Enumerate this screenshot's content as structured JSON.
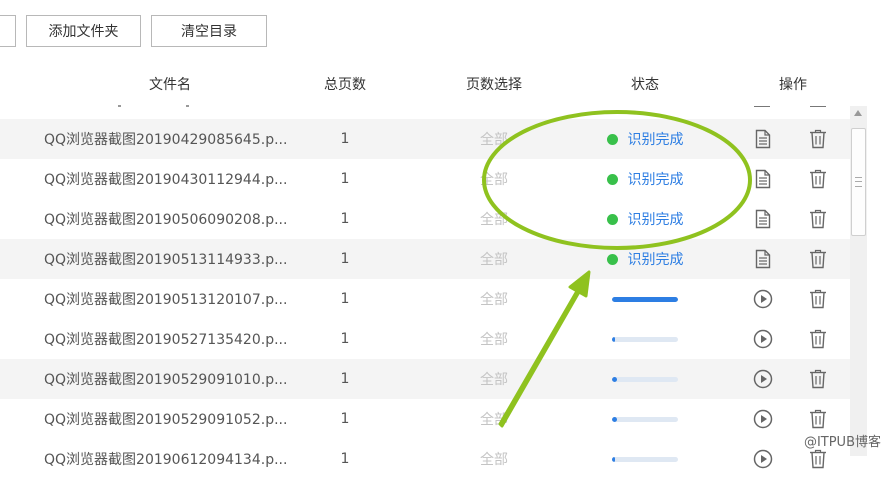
{
  "toolbar": {
    "add_folder_label": "添加文件夹",
    "clear_dir_label": "清空目录"
  },
  "header": {
    "filename": "文件名",
    "total_pages": "总页数",
    "page_select": "页数选择",
    "status": "状态",
    "actions": "操作"
  },
  "rows": [
    {
      "name": "QQ浏览器截图20190429085645.p...",
      "pages": "1",
      "selection": "全部",
      "status": "done",
      "status_text": "识别完成",
      "icons": [
        "document-icon",
        "trash-icon"
      ]
    },
    {
      "name": "QQ浏览器截图20190430112944.p...",
      "pages": "1",
      "selection": "全部",
      "status": "done",
      "status_text": "识别完成",
      "icons": [
        "document-icon",
        "trash-icon"
      ]
    },
    {
      "name": "QQ浏览器截图20190506090208.p...",
      "pages": "1",
      "selection": "全部",
      "status": "done",
      "status_text": "识别完成",
      "icons": [
        "document-icon",
        "trash-icon"
      ]
    },
    {
      "name": "QQ浏览器截图20190513114933.p...",
      "pages": "1",
      "selection": "全部",
      "status": "done",
      "status_text": "识别完成",
      "icons": [
        "document-icon",
        "trash-icon"
      ]
    },
    {
      "name": "QQ浏览器截图20190513120107.p...",
      "pages": "1",
      "selection": "全部",
      "status": "progress",
      "progress": 1.0,
      "icons": [
        "play-icon",
        "trash-icon"
      ]
    },
    {
      "name": "QQ浏览器截图20190527135420.p...",
      "pages": "1",
      "selection": "全部",
      "status": "progress",
      "progress": 0.05,
      "icons": [
        "play-icon",
        "trash-icon"
      ]
    },
    {
      "name": "QQ浏览器截图20190529091010.p...",
      "pages": "1",
      "selection": "全部",
      "status": "progress",
      "progress": 0.08,
      "icons": [
        "play-icon",
        "trash-icon"
      ]
    },
    {
      "name": "QQ浏览器截图20190529091052.p...",
      "pages": "1",
      "selection": "全部",
      "status": "progress",
      "progress": 0.08,
      "icons": [
        "play-icon",
        "trash-icon"
      ]
    },
    {
      "name": "QQ浏览器截图20190612094134.p...",
      "pages": "1",
      "selection": "全部",
      "status": "progress",
      "progress": 0.05,
      "icons": [
        "play-icon",
        "trash-icon"
      ]
    }
  ],
  "colors": {
    "accent": "#2d7ee3",
    "done_dot": "#38c04a",
    "annotation": "#8fc21f"
  },
  "watermark": "@ITPUB博客"
}
